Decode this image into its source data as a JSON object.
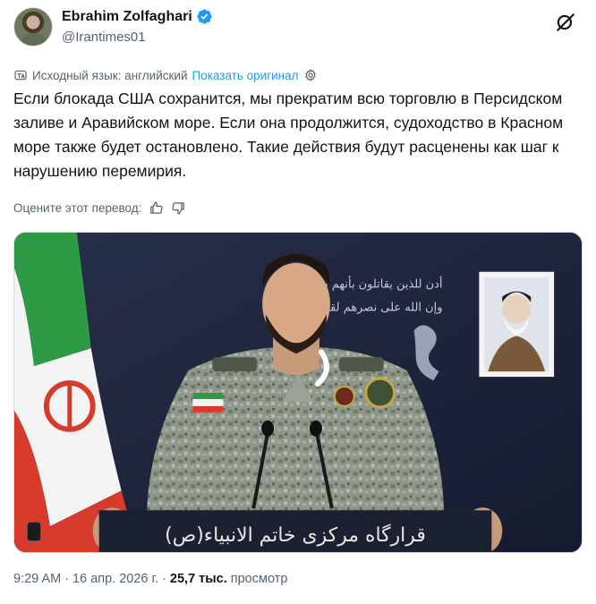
{
  "author": {
    "name": "Ebrahim Zolfaghari",
    "handle": "@Irantimes01",
    "verified": true
  },
  "translation": {
    "source_language": "Исходный язык: английский",
    "show_original": "Показать оригинал"
  },
  "tweet": {
    "text": "Если блокада США сохранится, мы прекратим всю торговлю в Персидском заливе и Аравийском море. Если она продолжится, судоходство в Красном море также будет остановлено. Такие действия будут расценены как шаг к нарушению перемирия."
  },
  "rating": {
    "label": "Оцените этот перевод:"
  },
  "media": {
    "podium_text": "قرارگاه مرکزی خاتم الانبیاء(ص)",
    "wall_calligraphy_line1": "أدن للذين يقاتلون بأنهم ظلموا",
    "wall_calligraphy_line2": "وإن الله على نصرهم لقدير"
  },
  "meta": {
    "time": "9:29 AM",
    "separator1": "·",
    "date": "16 апр. 2026 г.",
    "separator2": "·",
    "views_count": "25,7 тыс.",
    "views_label": "просмотр"
  },
  "colors": {
    "link": "#1d9bf0",
    "secondary_text": "#536471",
    "verified": "#1d9bf0"
  },
  "icons": [
    "verified-badge-icon",
    "grok-icon",
    "translate-icon",
    "settings-icon",
    "thumbs-up-icon",
    "thumbs-down-icon"
  ]
}
